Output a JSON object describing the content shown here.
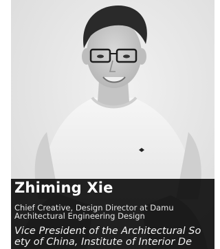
{
  "profile": {
    "name": "Zhiming Xie",
    "role": "Chief Creative, Design Director at Damu Architectural Engineering Design",
    "bio_line1": "Vice President of the Architectural So",
    "bio_line2": "ety of China, Institute of Interior De"
  },
  "colors": {
    "caption_bg": "#000000",
    "caption_text": "#ffffff",
    "photo_bg": "#e9e9e9"
  }
}
